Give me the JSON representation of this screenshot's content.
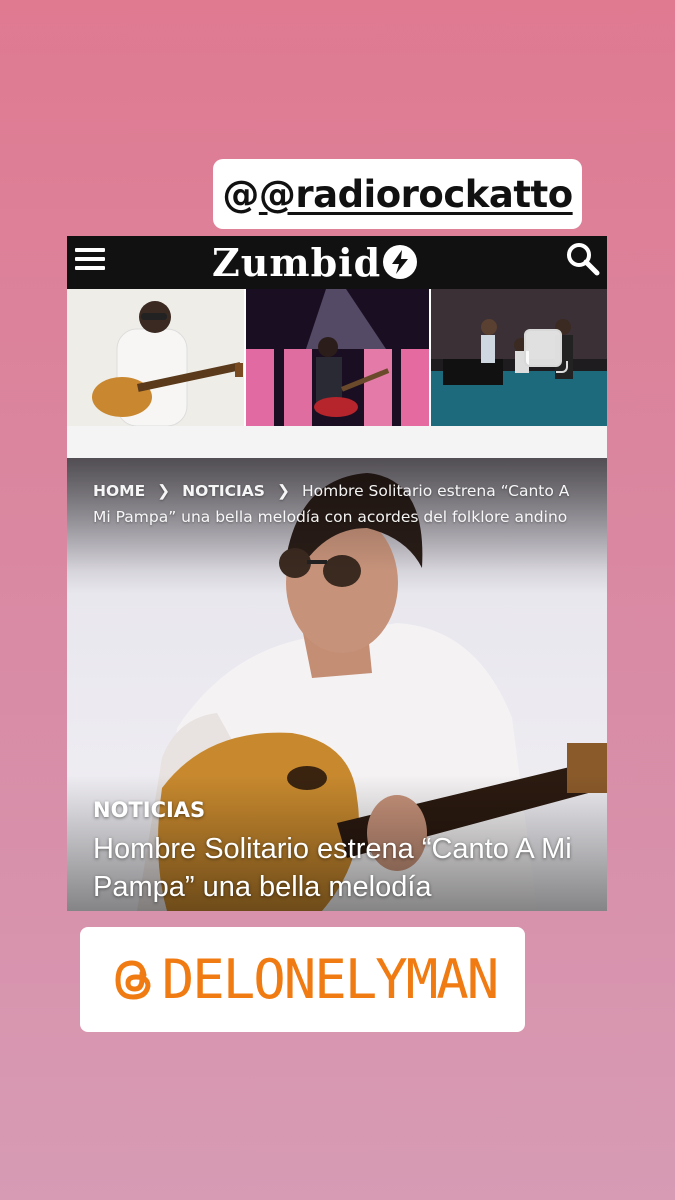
{
  "story": {
    "mention_top": "@radiorockatto",
    "mention_bottom": "DELONELYMAN",
    "mention_bottom_icon": "threads-icon"
  },
  "site": {
    "logo_text": "Zumbid",
    "logo_icon": "lightning-disc-icon",
    "menu_icon": "hamburger-menu-icon",
    "search_icon": "search-icon"
  },
  "breadcrumb": {
    "home": "HOME",
    "category": "NOTICIAS",
    "current": "Hombre Solitario estrena “Canto A Mi Pampa” una bella melodía con acordes del folklore andino"
  },
  "article": {
    "category": "NOTICIAS",
    "headline": "Hombre Solitario estrena “Canto A Mi Pampa” una bella melodía"
  },
  "colors": {
    "background_top": "#df7a91",
    "background_bottom": "#d79bb4",
    "bottom_mention_text": "#f07b12"
  }
}
